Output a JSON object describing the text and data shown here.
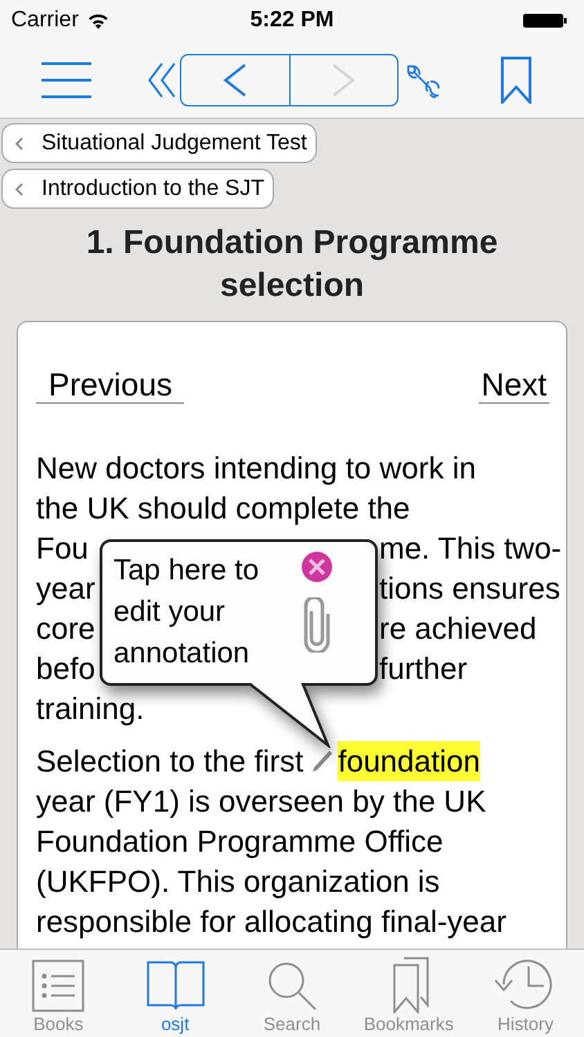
{
  "status_bar": {
    "carrier": "Carrier",
    "time": "5:22 PM"
  },
  "toolbar": {
    "back_enabled": true,
    "forward_enabled": false
  },
  "breadcrumbs": [
    "Situational Judgement Test",
    "Introduction to the SJT"
  ],
  "title": "1. Foundation Programme selection",
  "pager": {
    "previous": "Previous",
    "next": "Next"
  },
  "paragraphs": [
    {
      "kind": "lines",
      "lines": [
        {
          "text": "New doctors intending to work in"
        },
        {
          "text": "the UK should complete the"
        },
        {
          "left": "Fou",
          "right": "me. This two-"
        },
        {
          "left": "year",
          "right": "tions ensures"
        },
        {
          "left": "core",
          "right": "re achieved"
        },
        {
          "left": "befo",
          "right": "further"
        },
        {
          "text": "training."
        }
      ]
    },
    {
      "kind": "annotated",
      "before": "Selection to the first",
      "highlight": "foundation",
      "lines": [
        "year (FY1) is overseen by the UK",
        "Foundation Programme Office",
        "(UKFPO). This organization is",
        "responsible for allocating final-year"
      ]
    }
  ],
  "annotation_popup": {
    "text": "Tap here to edit your annotation"
  },
  "tab_bar": [
    {
      "label": "Books",
      "selected": false
    },
    {
      "label": "osjt",
      "selected": true
    },
    {
      "label": "Search",
      "selected": false
    },
    {
      "label": "Bookmarks",
      "selected": false
    },
    {
      "label": "History",
      "selected": false
    }
  ]
}
